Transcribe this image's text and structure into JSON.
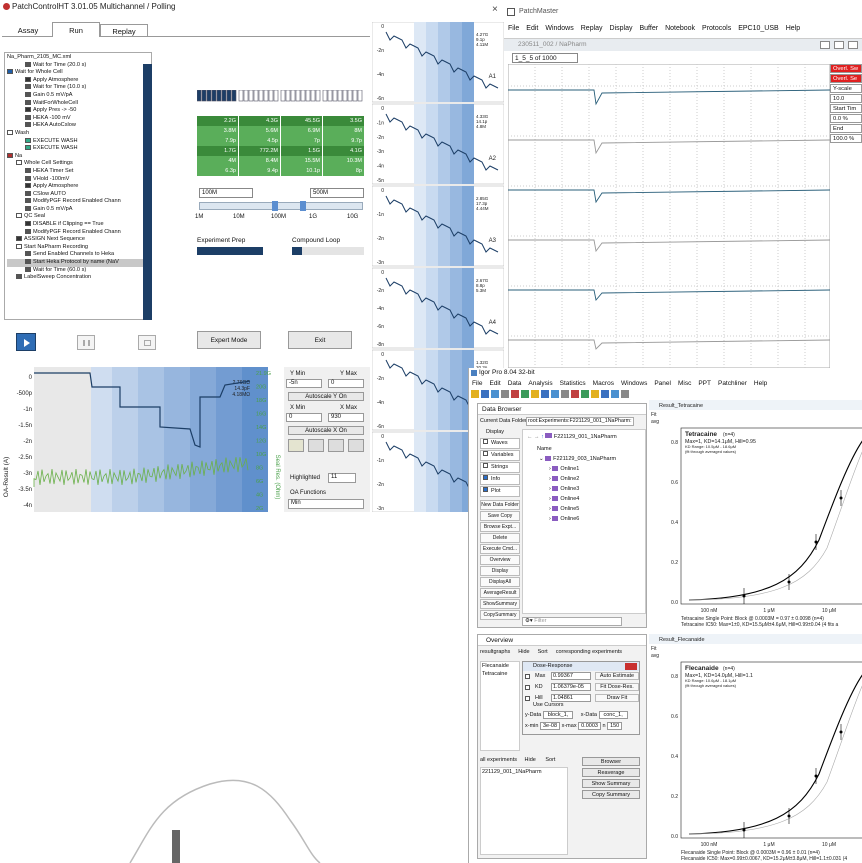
{
  "pc": {
    "title": "PatchControlHT 3.01.05  Multichannel / Polling",
    "tabs": [
      "Assay",
      "Run",
      "Replay"
    ],
    "tree": [
      {
        "t": "Na_Pharm_2105_MC.xml",
        "d": 0,
        "c": "none"
      },
      {
        "t": "Wait for Time (20.0 s)",
        "d": 2,
        "c": "#555"
      },
      {
        "t": "Wait for Whole Cell",
        "d": 0,
        "c": "#1f5ea8"
      },
      {
        "t": "Apply Atmosphere",
        "d": 2,
        "c": "#333"
      },
      {
        "t": "Wait for Time (10.0 s)",
        "d": 2,
        "c": "#555"
      },
      {
        "t": "Gain 0.5 mV/pA",
        "d": 2,
        "c": "#555"
      },
      {
        "t": "WaitForWholeCell",
        "d": 2,
        "c": "#555"
      },
      {
        "t": "Apply Pres -> -50",
        "d": 2,
        "c": "#333"
      },
      {
        "t": "HEKA -100 mV",
        "d": 2,
        "c": "#555"
      },
      {
        "t": "HEKA AutoCslow",
        "d": 2,
        "c": "#555"
      },
      {
        "t": "Wash",
        "d": 0,
        "c": "#fff"
      },
      {
        "t": "EXECUTE WASH",
        "d": 2,
        "c": "#3a8"
      },
      {
        "t": "EXECUTE WASH",
        "d": 2,
        "c": "#3a8"
      },
      {
        "t": "Na",
        "d": 0,
        "c": "#b03030"
      },
      {
        "t": "Whole Cell Settings",
        "d": 1,
        "c": "#fff"
      },
      {
        "t": "HEKA Timer Set",
        "d": 2,
        "c": "#555"
      },
      {
        "t": "VHold -100mV",
        "d": 2,
        "c": "#555"
      },
      {
        "t": "Apply Atmosphere",
        "d": 2,
        "c": "#333"
      },
      {
        "t": "CSlow AUTO",
        "d": 2,
        "c": "#555"
      },
      {
        "t": "ModifyPGF Record Enabled Chann",
        "d": 2,
        "c": "#555"
      },
      {
        "t": "Gain 0.5 mV/pA",
        "d": 2,
        "c": "#555"
      },
      {
        "t": "QC Seal",
        "d": 1,
        "c": "#fff"
      },
      {
        "t": "DISABLE if Clipping == True",
        "d": 2,
        "c": "#333"
      },
      {
        "t": "ModifyPGF Record Enabled Chann",
        "d": 2,
        "c": "#555"
      },
      {
        "t": "ASSIGN Next Sequence",
        "d": 1,
        "c": "#333"
      },
      {
        "t": "Start NaPharm Recording",
        "d": 1,
        "c": "#fff"
      },
      {
        "t": "Send Enabled Channels to Heka",
        "d": 2,
        "c": "#555"
      },
      {
        "t": "Start Heka Protocol by name (NaV",
        "d": 2,
        "c": "#555",
        "sel": true
      },
      {
        "t": "Wait for Time (60.0 s)",
        "d": 2,
        "c": "#555"
      },
      {
        "t": "LabelSweep Concentration",
        "d": 1,
        "c": "#555"
      }
    ],
    "grid_rows": [
      [
        "2.2G",
        "4.3G",
        "45.5G",
        "3.5G"
      ],
      [
        "3.8M",
        "5.6M",
        "6.9M",
        "8M"
      ],
      [
        "7.9p",
        "4.5p",
        "7p",
        "9.7p"
      ],
      [
        "1.7G",
        "772.2M",
        "1.5G",
        "4.1G"
      ],
      [
        "4M",
        "8.4M",
        "15.5M",
        "10.3M"
      ],
      [
        "6.3p",
        "9.4p",
        "10.1p",
        "8p"
      ]
    ],
    "range_left": "100M",
    "range_right": "500M",
    "ticks": [
      "1M",
      "10M",
      "100M",
      "1G",
      "10G"
    ],
    "exp_prep": "Experiment  Prep",
    "compound_loop": "Compound Loop",
    "expert": "Expert Mode",
    "exit": "Exit",
    "oa_ylabel": "OA-Result  (A)",
    "oa_yticks": [
      "0",
      "-500p",
      "-1n",
      "-1.5n",
      "-2n",
      "-2.5n",
      "-3n",
      "-3.5n",
      "-4n"
    ],
    "seal_ticks": [
      "21.9G",
      "20G",
      "18G",
      "16G",
      "14G",
      "12G",
      "10G",
      "8G",
      "6G",
      "4G",
      "2G"
    ],
    "seal_label": "Seal Res. (Ohm)",
    "oa_info": [
      "2.76GΩ",
      "14.3pF",
      "4.18MΩ"
    ],
    "ymin": "Y Min",
    "ymax": "Y Max",
    "ymin_v": "-5n",
    "ymax_v": "0",
    "autoy": "Autoscale Y On",
    "xmin": "X Min",
    "xmax": "X Max",
    "xmin_v": "0",
    "xmax_v": "930",
    "autox": "Autoscale X On",
    "highlighted": "Highlighted",
    "hl_v": "11",
    "oa_func": "OA Functions",
    "oa_sel": "Min"
  },
  "strip": {
    "labels": [
      "A1",
      "A2",
      "A3",
      "A4",
      "A5"
    ],
    "info": [
      [
        "4.27G",
        "9.1p",
        "4.11M"
      ],
      [
        "4.33G",
        "14.1p",
        "4.8M"
      ],
      [
        "2.85G",
        "17.3p",
        "4.44M"
      ],
      [
        "2.67G",
        "8.8p",
        "5.3M"
      ],
      [
        "1.32G",
        "20.3p",
        "5.55M"
      ]
    ],
    "yticks": [
      [
        "0",
        "-2n",
        "-4n",
        "-6n"
      ],
      [
        "0",
        "-1n",
        "-2n",
        "-3n",
        "-4n",
        "-5n"
      ],
      [
        "0",
        "-1n",
        "-2n",
        "-3n"
      ],
      [
        "0",
        "-2n",
        "-4n",
        "-6n",
        "-8n"
      ],
      [
        "0",
        "-2n",
        "-4n",
        "-6n"
      ],
      [
        "0",
        "-1n",
        "-2n",
        "-3n"
      ]
    ]
  },
  "pm": {
    "title": "PatchMaster",
    "menu": [
      "File",
      "Edit",
      "Windows",
      "Replay",
      "Display",
      "Buffer",
      "Notebook",
      "Protocols",
      "EPC10_USB",
      "Help"
    ],
    "sub": "230511_002 / NaPharm",
    "field": "1_5_5 of 1000",
    "right": [
      "Overl. Sw",
      "Overl. Se",
      "Y-scale",
      "10.0",
      "Start Tim",
      "0.0 %",
      "End",
      "100.0 %"
    ]
  },
  "igor": {
    "title": "Igor Pro 8.04 32-bit",
    "menu": [
      "File",
      "Edit",
      "Data",
      "Analysis",
      "Statistics",
      "Macros",
      "Windows",
      "Panel",
      "Misc",
      "PPT",
      "Patchliner",
      "Help"
    ],
    "browser": "Data Browser",
    "folder_label": "Current Data Folder:",
    "folder": "root:Experiments:F221129_001_1NaPharm:",
    "display": "Display",
    "checks": [
      "Waves",
      "Variables",
      "Strings",
      "Info",
      "Plot"
    ],
    "checked": [
      false,
      false,
      false,
      true,
      true
    ],
    "path": "F221129_001_1NaPharm",
    "name_hdr": "Name",
    "root": "F221129_003_1NaPharm",
    "folders": [
      "Online1",
      "Online2",
      "Online3",
      "Online4",
      "Online5",
      "Online6"
    ],
    "side_btns": [
      "New Data Folder",
      "Save Copy",
      "Browse Expt...",
      "Delete",
      "Execute Cmd...",
      "Overview",
      "Display",
      "DisplayAll",
      "AverageResult",
      "ShowSummary",
      "CopySummary"
    ],
    "filter": "Filter",
    "overview": "Overview",
    "ov_tabs": [
      "resultgraphs",
      "Hide",
      "Sort",
      "corresponding experiments"
    ],
    "compounds": [
      "Flecanaide",
      "Tetracaine"
    ],
    "dr_title": "Dose-Response",
    "dr": [
      [
        "Max",
        "0.99367",
        "Auto Estimate"
      ],
      [
        "KD",
        "1.06379e-05",
        "Fit Dose-Res."
      ],
      [
        "Hill",
        "1.04861",
        "Draw Fit"
      ]
    ],
    "use_cursors": "Use Cursors",
    "ydata": "y-Data",
    "ydata_v": "block_1,",
    "xdata": "x-Data",
    "xdata_v": "conc_1,",
    "xmin": "x-min",
    "xmin_v": "3e-08",
    "xmax": "x-max",
    "xmax_v": "0.0003",
    "n": "n",
    "n_v": "150",
    "all_exp": "all experiments",
    "hide": "Hide",
    "sort": "Sort",
    "exp": "221129_001_1NaPharm",
    "browser_btn": "Browser",
    "reaverage": "Reaverage",
    "show_summary": "Show Summary",
    "copy_summary": "Copy Summary",
    "r1_title": "Result_Tetracaine",
    "r2_title": "Result_Flecanaide",
    "fit": "Fit",
    "avg": "avg",
    "r1_name": "Tetracaine",
    "r1_n": "(n=4)",
    "r1_l1": "Max=1, KD=14.1μM, Hill=0.95",
    "r1_l2": "KD Range: 10.5μM - 18.6μM",
    "r1_l3": "(fit through averaged values)",
    "r1_foot1": "Tetracaine Single Point: Block @ 0.0003M = 0.97 ± 0.0098 (n=4)",
    "r1_foot2": "Tetracaine IC50: Max=1±0, KD=15.5μM±4.6μM, Hill=0.99±0.04 (4 fits a",
    "r2_name": "Flecanaide",
    "r2_n": "(n=4)",
    "r2_l1": "Max=1, KD=14.0μM, Hill=1.1",
    "r2_l2": "KD Range: 10.6μM - 18.1μM",
    "r2_l3": "(fit through averaged values)",
    "r2_foot1": "Flecanaide Single Point: Block @ 0.0003M = 0.96 ± 0.01 (n=4)",
    "r2_foot2": "Flecanaide IC50: Max=0.99±0.0067, KD=15.2μM±3.8μM, Hill=1.1±0.031 (4",
    "xticks": [
      "100 nM",
      "1 μM",
      "10 μM"
    ],
    "yticks": [
      "0.0",
      "0.2",
      "0.4",
      "0.6",
      "0.8"
    ]
  },
  "colors": {
    "green": "#4aa04a",
    "blue_dark": "#1c3e66",
    "accent": "#2a5fa8"
  }
}
